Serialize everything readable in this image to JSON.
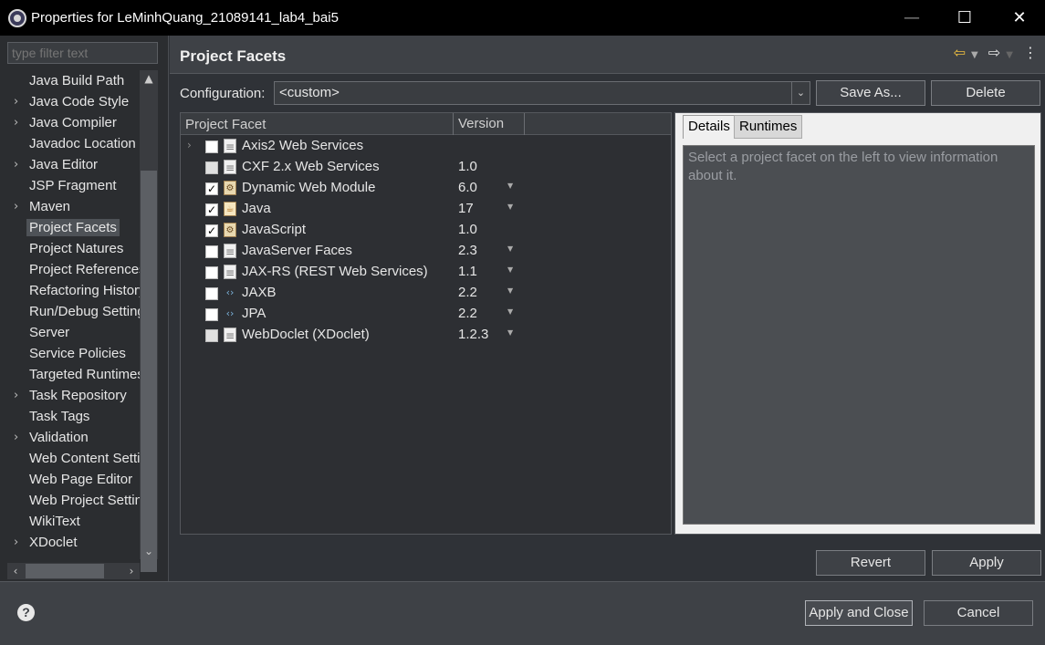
{
  "window": {
    "title": "Properties for LeMinhQuang_21089141_lab4_bai5",
    "minimize_glyph": "—",
    "maximize_glyph": "☐",
    "close_glyph": "✕"
  },
  "sidebar": {
    "filter_placeholder": "type filter text",
    "items": [
      {
        "label": "Java Build Path",
        "expandable": false
      },
      {
        "label": "Java Code Style",
        "expandable": true
      },
      {
        "label": "Java Compiler",
        "expandable": true
      },
      {
        "label": "Javadoc Location",
        "expandable": false
      },
      {
        "label": "Java Editor",
        "expandable": true
      },
      {
        "label": "JSP Fragment",
        "expandable": false
      },
      {
        "label": "Maven",
        "expandable": true
      },
      {
        "label": "Project Facets",
        "expandable": false,
        "selected": true
      },
      {
        "label": "Project Natures",
        "expandable": false
      },
      {
        "label": "Project References",
        "expandable": false
      },
      {
        "label": "Refactoring History",
        "expandable": false
      },
      {
        "label": "Run/Debug Settings",
        "expandable": false
      },
      {
        "label": "Server",
        "expandable": false
      },
      {
        "label": "Service Policies",
        "expandable": false
      },
      {
        "label": "Targeted Runtimes",
        "expandable": false
      },
      {
        "label": "Task Repository",
        "expandable": true
      },
      {
        "label": "Task Tags",
        "expandable": false
      },
      {
        "label": "Validation",
        "expandable": true
      },
      {
        "label": "Web Content Settings",
        "expandable": false
      },
      {
        "label": "Web Page Editor",
        "expandable": false
      },
      {
        "label": "Web Project Settings",
        "expandable": false
      },
      {
        "label": "WikiText",
        "expandable": false
      },
      {
        "label": "XDoclet",
        "expandable": true
      }
    ]
  },
  "main": {
    "title": "Project Facets",
    "configuration_label": "Configuration:",
    "configuration_value": "<custom>",
    "save_as_label": "Save As...",
    "delete_label": "Delete",
    "table": {
      "col_facet": "Project Facet",
      "col_version": "Version",
      "rows": [
        {
          "name": "Axis2 Web Services",
          "version": "",
          "checked": false,
          "icon": "doc",
          "expander": true,
          "dropdown": false
        },
        {
          "name": "CXF 2.x Web Services",
          "version": "1.0",
          "checked": false,
          "icon": "doc",
          "expander": false,
          "dropdown": false
        },
        {
          "name": "Dynamic Web Module",
          "version": "6.0",
          "checked": true,
          "icon": "web",
          "expander": false,
          "dropdown": true
        },
        {
          "name": "Java",
          "version": "17",
          "checked": true,
          "icon": "cup",
          "expander": false,
          "dropdown": true
        },
        {
          "name": "JavaScript",
          "version": "1.0",
          "checked": true,
          "icon": "web",
          "expander": false,
          "dropdown": false
        },
        {
          "name": "JavaServer Faces",
          "version": "2.3",
          "checked": false,
          "icon": "doc",
          "expander": false,
          "dropdown": true
        },
        {
          "name": "JAX-RS (REST Web Services)",
          "version": "1.1",
          "checked": false,
          "icon": "doc",
          "expander": false,
          "dropdown": true
        },
        {
          "name": "JAXB",
          "version": "2.2",
          "checked": false,
          "icon": "xml",
          "expander": false,
          "dropdown": true
        },
        {
          "name": "JPA",
          "version": "2.2",
          "checked": false,
          "icon": "xml",
          "expander": false,
          "dropdown": true
        },
        {
          "name": "WebDoclet (XDoclet)",
          "version": "1.2.3",
          "checked": false,
          "icon": "doc",
          "expander": false,
          "dropdown": true
        }
      ]
    },
    "details": {
      "tab_details": "Details",
      "tab_runtimes": "Runtimes",
      "info_text": "Select a project facet on the left to view information about it."
    },
    "revert_label": "Revert",
    "apply_label": "Apply"
  },
  "footer": {
    "help_glyph": "?",
    "apply_close_label": "Apply and Close",
    "cancel_label": "Cancel"
  }
}
